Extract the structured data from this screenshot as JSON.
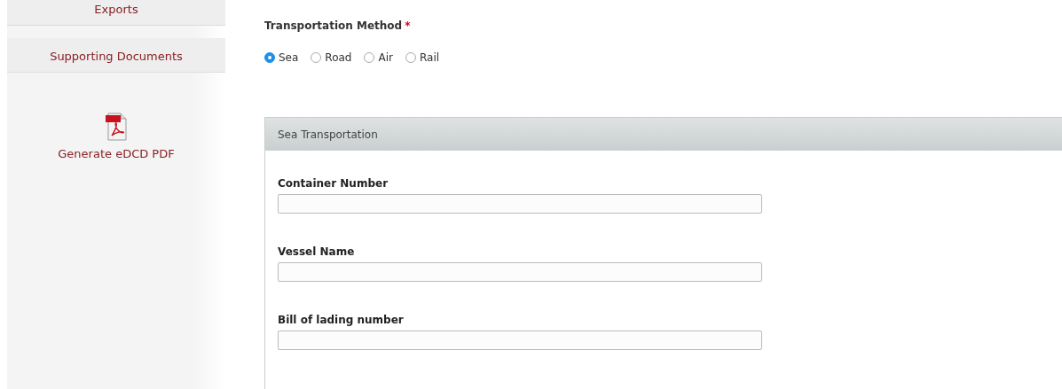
{
  "sidebar": {
    "items": [
      {
        "label": "Exports"
      },
      {
        "label": "Supporting Documents"
      }
    ],
    "action": {
      "label": "Generate eDCD PDF"
    }
  },
  "transportation_method": {
    "label": "Transportation Method",
    "required_mark": "*",
    "options": [
      {
        "label": "Sea",
        "selected": true
      },
      {
        "label": "Road",
        "selected": false
      },
      {
        "label": "Air",
        "selected": false
      },
      {
        "label": "Rail",
        "selected": false
      }
    ]
  },
  "panel": {
    "title": "Sea Transportation",
    "fields": [
      {
        "label": "Container Number"
      },
      {
        "label": "Vessel Name"
      },
      {
        "label": "Bill of lading number"
      }
    ]
  }
}
